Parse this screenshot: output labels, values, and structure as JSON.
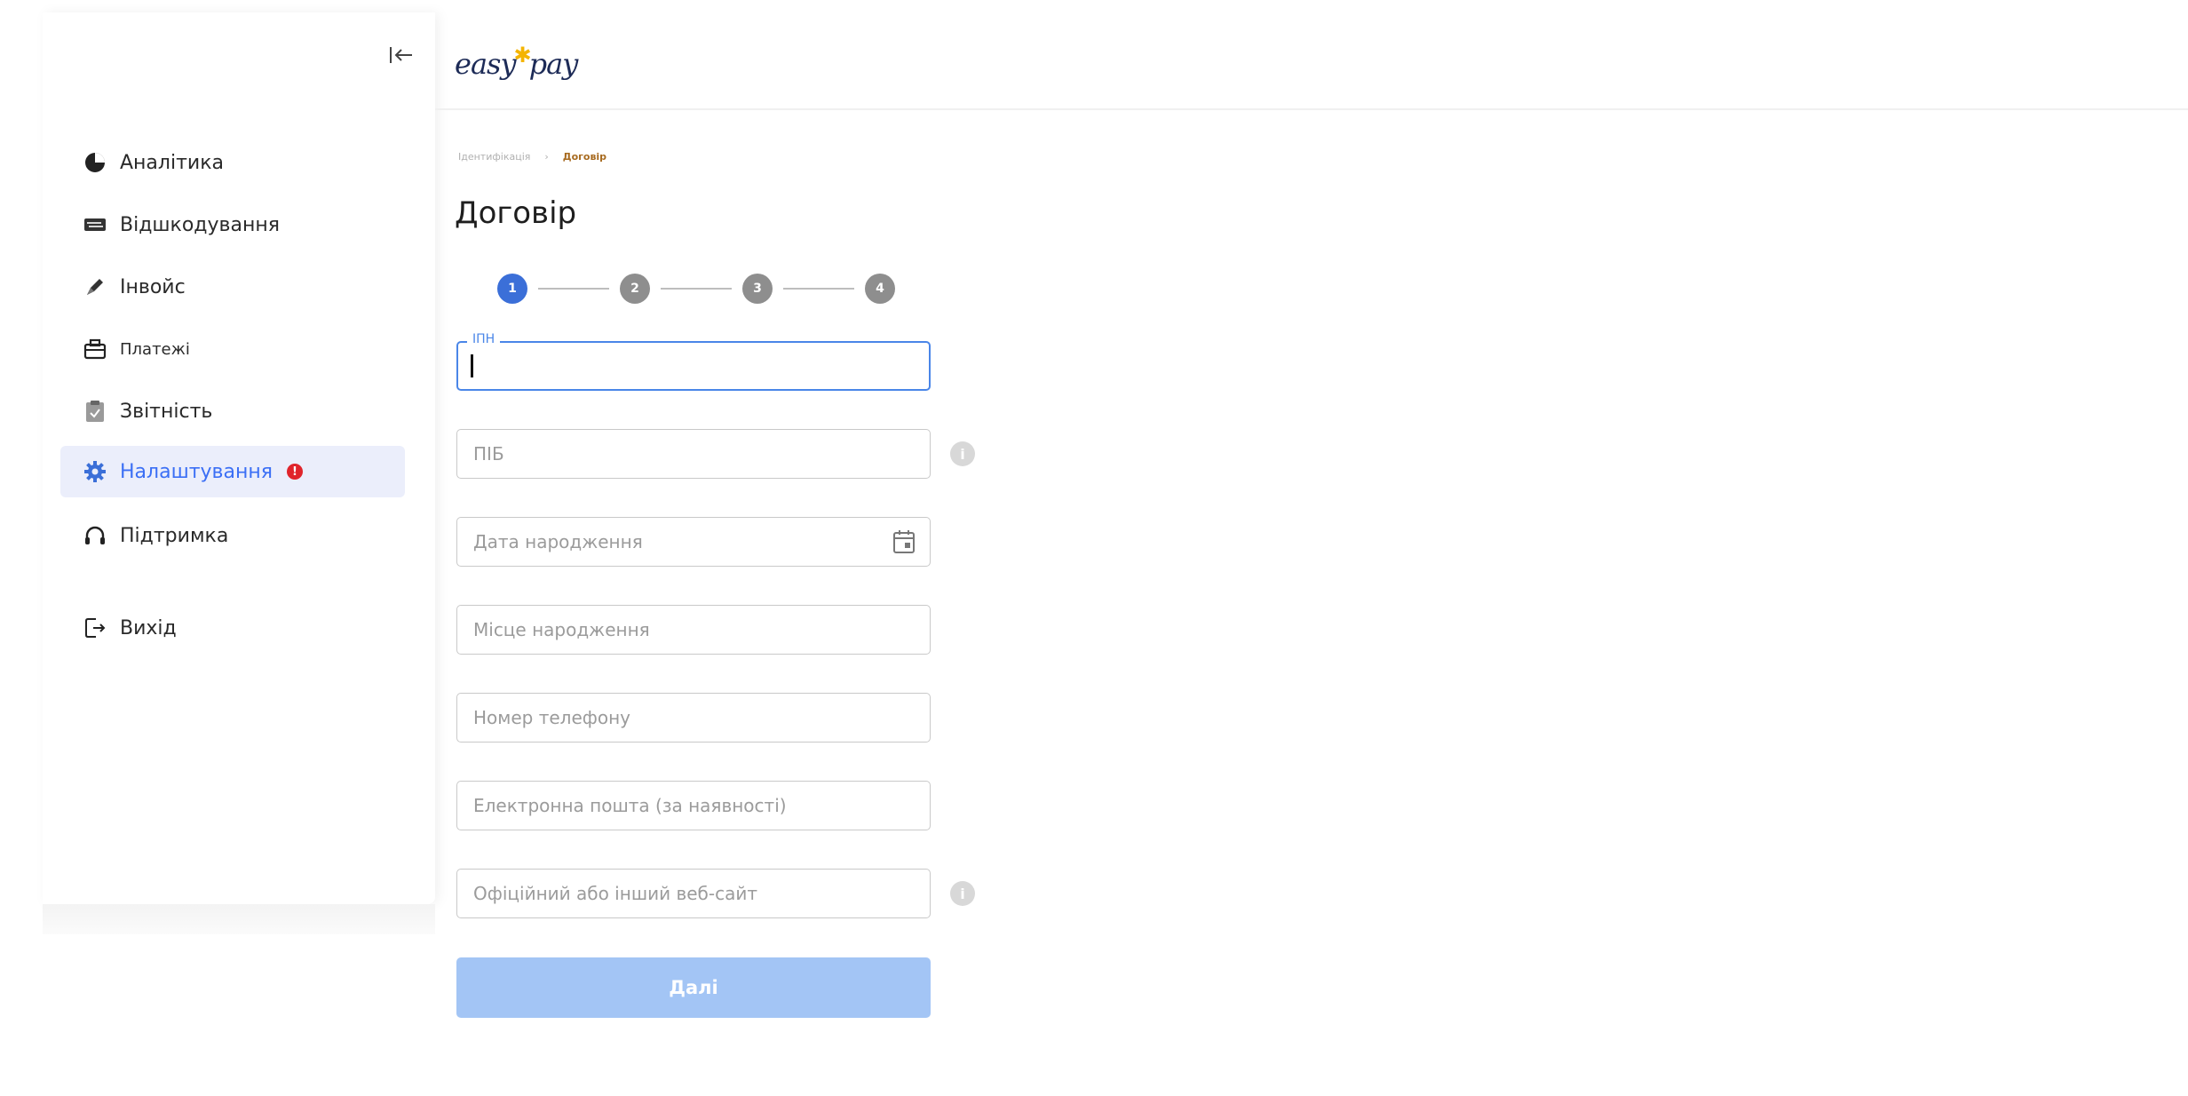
{
  "brand": {
    "logo_left": "easy",
    "logo_right": "pay"
  },
  "sidebar": {
    "items": [
      {
        "label": "Аналітика"
      },
      {
        "label": "Відшкодування"
      },
      {
        "label": "Інвойс"
      },
      {
        "label": "Платежі"
      },
      {
        "label": "Звітність"
      },
      {
        "label": "Налаштування",
        "badge": "!"
      },
      {
        "label": "Підтримка"
      },
      {
        "label": "Вихід"
      }
    ]
  },
  "breadcrumb": {
    "items": [
      "Ідентифікація",
      "Договір"
    ]
  },
  "page": {
    "title": "Договір"
  },
  "stepper": {
    "steps": [
      "1",
      "2",
      "3",
      "4"
    ],
    "current": 1
  },
  "form": {
    "ipn": {
      "label": "ІПН",
      "value": ""
    },
    "pib": {
      "placeholder": "ПІБ"
    },
    "birth_date": {
      "placeholder": "Дата народження"
    },
    "birth_place": {
      "placeholder": "Місце народження"
    },
    "phone": {
      "placeholder": "Номер телефону"
    },
    "email": {
      "placeholder": "Електронна пошта (за наявності)"
    },
    "website": {
      "placeholder": "Офіційний або інший веб-сайт"
    },
    "next_label": "Далі"
  },
  "colors": {
    "accent": "#3b6fd8",
    "active_nav_bg": "#ebeefb",
    "button_disabled": "#a3c5f5",
    "alert": "#e0242b"
  }
}
